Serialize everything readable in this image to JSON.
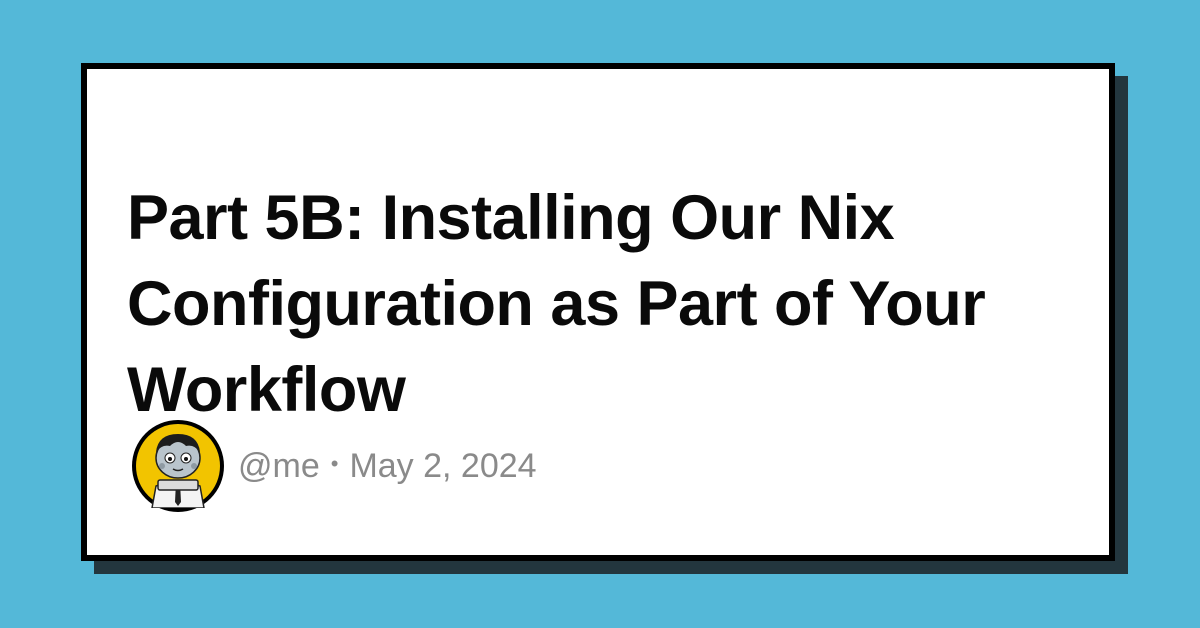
{
  "post": {
    "title": "Part 5B: Installing Our Nix Configuration as Part of Your Workflow",
    "author_handle": "@me",
    "separator": "•",
    "date": "May 2, 2024"
  },
  "colors": {
    "background": "#54b8d8",
    "card": "#ffffff",
    "card_border": "#000000",
    "card_shadow": "#23363e",
    "title_text": "#0a0a0a",
    "meta_text": "#8a8a8a",
    "avatar_ring": "#f2c400"
  },
  "icons": {
    "avatar": "cartoon-character-avatar"
  }
}
